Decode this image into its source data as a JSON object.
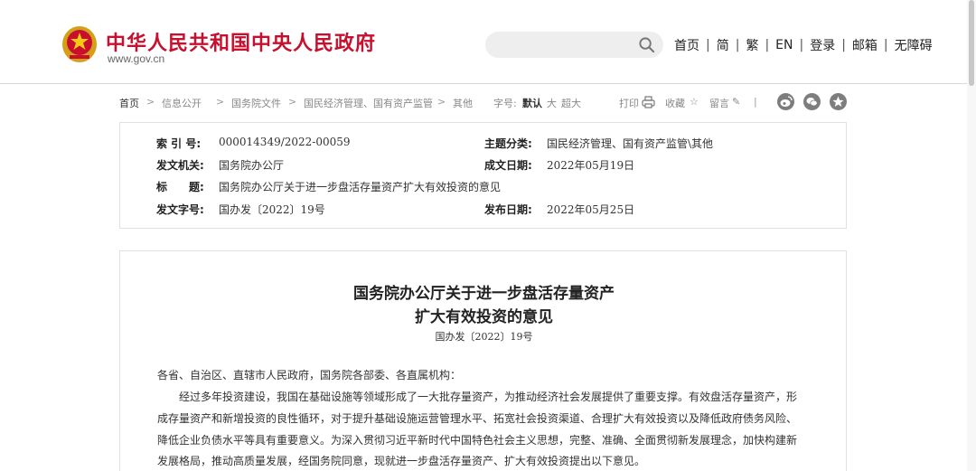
{
  "header": {
    "site_title": "中华人民共和国中央人民政府",
    "site_url": "www.gov.cn",
    "search": {
      "placeholder": "",
      "value": ""
    },
    "nav": [
      "首页",
      "简",
      "繁",
      "EN",
      "登录",
      "邮箱",
      "无障碍"
    ],
    "nav_separator": "|"
  },
  "breadcrumb": {
    "items": [
      "首页",
      "信息公开",
      "国务院文件",
      "国民经济管理、国有资产监管",
      "其他"
    ],
    "separator": ">",
    "font_size_label": "字号:",
    "font_default": "默认",
    "font_large": "大",
    "font_xlarge": "超大",
    "print": "打印",
    "favorite": "收藏",
    "comment": "留言",
    "divider": "|",
    "share_icons": [
      "weibo-icon",
      "wechat-icon",
      "qzone-icon"
    ]
  },
  "meta": {
    "index_label": "索 引 号:",
    "index_value": "000014349/2022-00059",
    "category_label": "主题分类:",
    "category_value": "国民经济管理、国有资产监管\\其他",
    "issuer_label": "发文机关:",
    "issuer_value": "国务院办公厅",
    "date_label": "成文日期:",
    "date_value": "2022年05月19日",
    "title_label": "标　　题:",
    "title_value": "国务院办公厅关于进一步盘活存量资产扩大有效投资的意见",
    "docno_label": "发文字号:",
    "docno_value": "国办发〔2022〕19号",
    "publish_label": "发布日期:",
    "publish_value": "2022年05月25日"
  },
  "article": {
    "title_line1": "国务院办公厅关于进一步盘活存量资产",
    "title_line2": "扩大有效投资的意见",
    "doc_number": "国办发〔2022〕19号",
    "salutation": "各省、自治区、直辖市人民政府，国务院各部委、各直属机构：",
    "lines": [
      "经过多年投资建设，我国在基础设施等领域形成了一大批存量资产，为推动经济社会发展提供了重要支撑。有效盘活存量资产，形",
      "成存量资产和新增投资的良性循环，对于提升基础设施运营管理水平、拓宽社会投资渠道、合理扩大有效投资以及降低政府债务风险、",
      "降低企业负债水平等具有重要意义。为深入贯彻习近平新时代中国特色社会主义思想，完整、准确、全面贯彻新发展理念，加快构建新",
      "发展格局，推动高质量发展，经国务院同意，现就进一步盘活存量资产、扩大有效投资提出以下意见。"
    ]
  },
  "colors": {
    "brand_red": "#c8102e",
    "share_gray": "#7d7d7d"
  }
}
